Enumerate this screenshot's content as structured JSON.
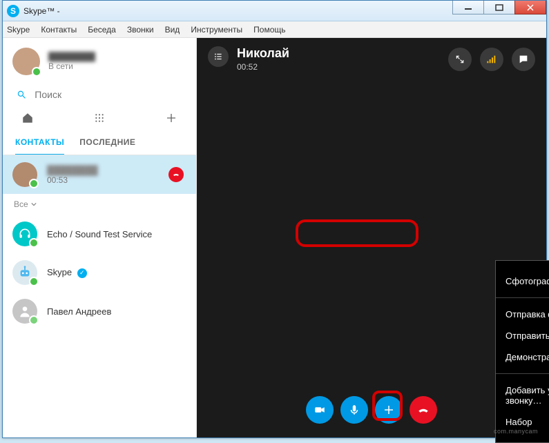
{
  "window": {
    "app_title": "Skype™ -",
    "minimize": "–",
    "maximize": "□",
    "close": "✕"
  },
  "menubar": {
    "items": [
      "Skype",
      "Контакты",
      "Беседа",
      "Звонки",
      "Вид",
      "Инструменты",
      "Помощь"
    ]
  },
  "profile": {
    "status": "В сети"
  },
  "search": {
    "placeholder": "Поиск"
  },
  "tabs": {
    "contacts": "КОНТАКТЫ",
    "recent": "ПОСЛЕДНИЕ"
  },
  "active_contact": {
    "time": "00:53"
  },
  "filter": {
    "label": "Все"
  },
  "contacts": [
    {
      "name": "Echo / Sound Test Service"
    },
    {
      "name": "Skype"
    },
    {
      "name": "Павел Андреев"
    }
  ],
  "call": {
    "name": "Николай",
    "duration": "00:52"
  },
  "popup": {
    "items": [
      "Сфотографировать…",
      "Отправка файлов…",
      "Отправить контакты…",
      "Демонстрация экрана…",
      "Добавить участников к этому звонку…",
      "Набор"
    ]
  },
  "watermark": "com.manycam"
}
